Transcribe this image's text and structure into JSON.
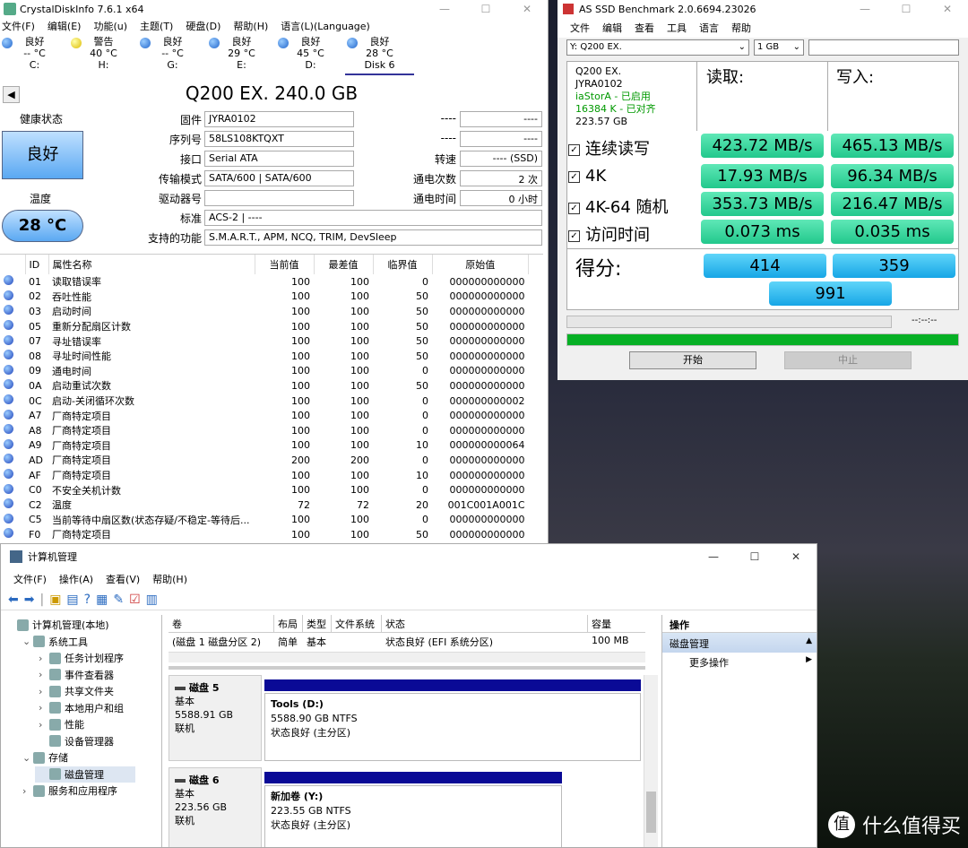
{
  "cdi": {
    "title": "CrystalDiskInfo 7.6.1 x64",
    "menu": [
      "文件(F)",
      "编辑(E)",
      "功能(u)",
      "主题(T)",
      "硬盘(D)",
      "帮助(H)",
      "语言(L)(Language)"
    ],
    "drives": [
      {
        "status": "良好",
        "temp": "-- °C",
        "letter": "C:",
        "dot": "blue"
      },
      {
        "status": "警告",
        "temp": "40 °C",
        "letter": "H:",
        "dot": "yellow"
      },
      {
        "status": "良好",
        "temp": "-- °C",
        "letter": "G:",
        "dot": "blue"
      },
      {
        "status": "良好",
        "temp": "29 °C",
        "letter": "E:",
        "dot": "blue"
      },
      {
        "status": "良好",
        "temp": "45 °C",
        "letter": "D:",
        "dot": "blue"
      },
      {
        "status": "良好",
        "temp": "28 °C",
        "letter": "Disk 6",
        "dot": "blue"
      }
    ],
    "disk_title": "Q200 EX. 240.0 GB",
    "health_label": "健康状态",
    "health_value": "良好",
    "temp_label": "温度",
    "temp_value": "28 °C",
    "firmware_label": "固件",
    "firmware": "JYRA0102",
    "serial_label": "序列号",
    "serial": "58LS108KTQXT",
    "interface_label": "接口",
    "interface": "Serial ATA",
    "transfer_label": "传输模式",
    "transfer": "SATA/600 | SATA/600",
    "driveletter_label": "驱动器号",
    "driveletter": "",
    "standard_label": "标准",
    "standard": "ACS-2 | ----",
    "features_label": "支持的功能",
    "features": "S.M.A.R.T., APM, NCQ, TRIM, DevSleep",
    "r1_label": "----",
    "r1": "----",
    "r2_label": "----",
    "r2": "----",
    "rotation_label": "转速",
    "rotation": "---- (SSD)",
    "powercount_label": "通电次数",
    "powercount": "2 次",
    "powerhours_label": "通电时间",
    "powerhours": "0 小时",
    "smart_headers": [
      "ID",
      "属性名称",
      "当前值",
      "最差值",
      "临界值",
      "原始值"
    ],
    "smart_rows": [
      [
        "01",
        "读取错误率",
        "100",
        "100",
        "0",
        "000000000000"
      ],
      [
        "02",
        "吞吐性能",
        "100",
        "100",
        "50",
        "000000000000"
      ],
      [
        "03",
        "启动时间",
        "100",
        "100",
        "50",
        "000000000000"
      ],
      [
        "05",
        "重新分配扇区计数",
        "100",
        "100",
        "50",
        "000000000000"
      ],
      [
        "07",
        "寻址错误率",
        "100",
        "100",
        "50",
        "000000000000"
      ],
      [
        "08",
        "寻址时间性能",
        "100",
        "100",
        "50",
        "000000000000"
      ],
      [
        "09",
        "通电时间",
        "100",
        "100",
        "0",
        "000000000000"
      ],
      [
        "0A",
        "启动重试次数",
        "100",
        "100",
        "50",
        "000000000000"
      ],
      [
        "0C",
        "启动-关闭循环次数",
        "100",
        "100",
        "0",
        "000000000002"
      ],
      [
        "A7",
        "厂商特定项目",
        "100",
        "100",
        "0",
        "000000000000"
      ],
      [
        "A8",
        "厂商特定项目",
        "100",
        "100",
        "0",
        "000000000000"
      ],
      [
        "A9",
        "厂商特定项目",
        "100",
        "100",
        "10",
        "000000000064"
      ],
      [
        "AD",
        "厂商特定项目",
        "200",
        "200",
        "0",
        "000000000000"
      ],
      [
        "AF",
        "厂商特定项目",
        "100",
        "100",
        "10",
        "000000000000"
      ],
      [
        "C0",
        "不安全关机计数",
        "100",
        "100",
        "0",
        "000000000000"
      ],
      [
        "C2",
        "温度",
        "72",
        "72",
        "20",
        "001C001A001C"
      ],
      [
        "C5",
        "当前等待中扇区数(状态存疑/不稳定-等待后...",
        "100",
        "100",
        "0",
        "000000000000"
      ],
      [
        "F0",
        "厂商特定项目",
        "100",
        "100",
        "50",
        "000000000000"
      ]
    ]
  },
  "asssd": {
    "title": "AS SSD Benchmark 2.0.6694.23026",
    "menu": [
      "文件",
      "编辑",
      "查看",
      "工具",
      "语言",
      "帮助"
    ],
    "drive_select": "Y: Q200 EX.",
    "size_select": "1 GB",
    "info": [
      "Q200 EX.",
      "JYRA0102",
      "iaStorA - 已启用",
      "16384 K - 已对齐",
      "223.57 GB"
    ],
    "read_header": "读取:",
    "write_header": "写入:",
    "rows": [
      {
        "label": "连续读写",
        "read": "423.72 MB/s",
        "write": "465.13 MB/s"
      },
      {
        "label": "4K",
        "read": "17.93 MB/s",
        "write": "96.34 MB/s"
      },
      {
        "label": "4K-64 随机",
        "read": "353.73 MB/s",
        "write": "216.47 MB/s"
      },
      {
        "label": "访问时间",
        "read": "0.073 ms",
        "write": "0.035 ms"
      }
    ],
    "score_label": "得分:",
    "score_read": "414",
    "score_write": "359",
    "score_total": "991",
    "time_readout": "--:--:--",
    "progress": 1.0,
    "start_label": "开始",
    "abort_label": "中止"
  },
  "cm": {
    "title": "计算机管理",
    "menu": [
      "文件(F)",
      "操作(A)",
      "查看(V)",
      "帮助(H)"
    ],
    "tree": [
      {
        "label": "计算机管理(本地)",
        "level": 0,
        "toggle": ""
      },
      {
        "label": "系统工具",
        "level": 1,
        "toggle": "⌄"
      },
      {
        "label": "任务计划程序",
        "level": 2,
        "toggle": "›"
      },
      {
        "label": "事件查看器",
        "level": 2,
        "toggle": "›"
      },
      {
        "label": "共享文件夹",
        "level": 2,
        "toggle": "›"
      },
      {
        "label": "本地用户和组",
        "level": 2,
        "toggle": "›"
      },
      {
        "label": "性能",
        "level": 2,
        "toggle": "›"
      },
      {
        "label": "设备管理器",
        "level": 2,
        "toggle": ""
      },
      {
        "label": "存储",
        "level": 1,
        "toggle": "⌄"
      },
      {
        "label": "磁盘管理",
        "level": 2,
        "toggle": ""
      },
      {
        "label": "服务和应用程序",
        "level": 1,
        "toggle": "›"
      }
    ],
    "vol_headers": [
      "卷",
      "布局",
      "类型",
      "文件系统",
      "状态",
      "容量"
    ],
    "vol_row": [
      "(磁盘 1 磁盘分区 2)",
      "简单",
      "基本",
      "",
      "状态良好 (EFI 系统分区)",
      "100 MB"
    ],
    "actions_header": "操作",
    "actions_section": "磁盘管理",
    "actions_more": "更多操作",
    "disks": [
      {
        "name": "磁盘 5",
        "type": "基本",
        "size": "5588.91 GB",
        "state": "联机",
        "vol": "Tools  (D:)",
        "vol_size": "5588.90 GB NTFS",
        "vol_state": "状态良好 (主分区)"
      },
      {
        "name": "磁盘 6",
        "type": "基本",
        "size": "223.56 GB",
        "state": "联机",
        "vol": "新加卷  (Y:)",
        "vol_size": "223.55 GB NTFS",
        "vol_state": "状态良好 (主分区)"
      }
    ]
  },
  "watermark": "什么值得买",
  "watermark_logo": "值"
}
